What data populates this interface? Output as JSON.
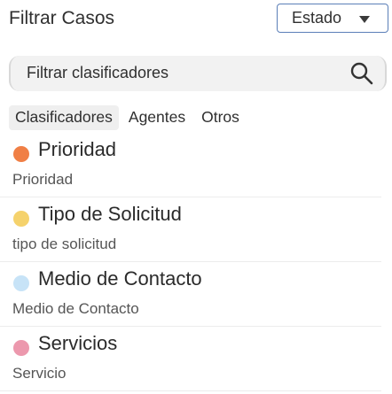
{
  "header": {
    "title": "Filtrar Casos",
    "state_select": {
      "selected": "Estado"
    }
  },
  "search": {
    "placeholder": "Filtrar clasificadores",
    "icon": "search-icon"
  },
  "tabs": [
    {
      "label": "Clasificadores",
      "active": true
    },
    {
      "label": "Agentes",
      "active": false
    },
    {
      "label": "Otros",
      "active": false
    }
  ],
  "classifiers": [
    {
      "title": "Prioridad",
      "subtitle": "Prioridad",
      "color": "#f07f45"
    },
    {
      "title": "Tipo de Solicitud",
      "subtitle": "tipo de solicitud",
      "color": "#f5d26c"
    },
    {
      "title": "Medio de Contacto",
      "subtitle": "Medio de Contacto",
      "color": "#c7e3f7"
    },
    {
      "title": "Servicios",
      "subtitle": "Servicio",
      "color": "#ec98ad"
    }
  ]
}
